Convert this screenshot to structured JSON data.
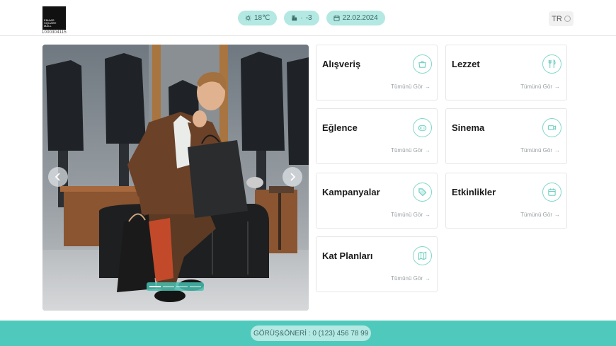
{
  "header": {
    "logo": {
      "lines": [
        "EMAAR",
        "SQUARE",
        "MALL"
      ],
      "code": "1000304115"
    },
    "weather": "18℃",
    "parking": "-3",
    "date": "22.02.2024",
    "language": "TR"
  },
  "hero": {
    "prev_icon": "chevron-left-icon",
    "next_icon": "chevron-right-icon",
    "slides": 4,
    "active_slide": 1
  },
  "categories": [
    {
      "title": "Alışveriş",
      "icon": "shopping-basket-icon",
      "more": "Tümünü Gör"
    },
    {
      "title": "Lezzet",
      "icon": "fork-knife-icon",
      "more": "Tümünü Gör"
    },
    {
      "title": "Eğlence",
      "icon": "gamepad-icon",
      "more": "Tümünü Gör"
    },
    {
      "title": "Sinema",
      "icon": "video-camera-icon",
      "more": "Tümünü Gör"
    },
    {
      "title": "Kampanyalar",
      "icon": "tag-icon",
      "more": "Tümünü Gör"
    },
    {
      "title": "Etkinlikler",
      "icon": "calendar-icon",
      "more": "Tümünü Gör"
    },
    {
      "title": "Kat Planları",
      "icon": "map-icon",
      "more": "Tümünü Gör"
    }
  ],
  "footer": {
    "contact": "GÖRÜŞ&ÖNERİ : 0 (123) 456 78 99"
  },
  "colors": {
    "accent": "#4fc9bb",
    "pill": "#b4e8e2",
    "pill_text": "#3a6b66"
  }
}
